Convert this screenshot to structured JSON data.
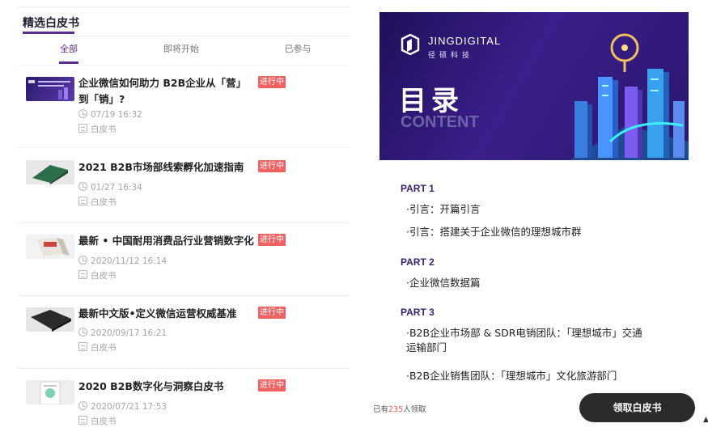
{
  "section_title": "精选白皮书",
  "tabs": [
    {
      "label": "全部",
      "active": true
    },
    {
      "label": "即将开始",
      "active": false
    },
    {
      "label": "已参与",
      "active": false
    }
  ],
  "items": [
    {
      "title": "企业微信如何助力 B2B企业从「营」到「销」?",
      "badge": "进行中",
      "time": "07/19 16:32",
      "type": "白皮书"
    },
    {
      "title": "2021 B2B市场部线索孵化加速指南",
      "badge": "进行中",
      "time": "01/27 16:34",
      "type": "白皮书"
    },
    {
      "title": "最新 • 中国耐用消费品行业营销数字化",
      "badge": "进行中",
      "time": "2020/11/12 16:14",
      "type": "白皮书"
    },
    {
      "title": "最新中文版•定义微信运营权威基准",
      "badge": "进行中",
      "time": "2020/09/17 16:21",
      "type": "白皮书"
    },
    {
      "title": "2020 B2B数字化与洞察白皮书",
      "badge": "进行中",
      "time": "2020/07/21 17:53",
      "type": "白皮书"
    }
  ],
  "banner": {
    "brand": "JINGDIGITAL",
    "brand_sub": "径硕科技",
    "title": "目录",
    "subtitle": "CONTENT"
  },
  "toc": [
    {
      "part": "PART 1",
      "lines": [
        "·引言：开篇引言",
        "·引言：搭建关于企业微信的理想城市群"
      ]
    },
    {
      "part": "PART 2",
      "lines": [
        "·企业微信数据篇"
      ]
    },
    {
      "part": "PART 3",
      "lines": [
        "·B2B企业市场部 & SDR电销团队：「理想城市」交通运输部门",
        "·B2B企业销售团队：「理想城市」文化旅游部门"
      ]
    }
  ],
  "footer": {
    "claimed_prefix": "已有",
    "claimed_count": "235",
    "claimed_suffix": "人领取",
    "button_label": "领取白皮书"
  },
  "colors": {
    "accent": "#5b2d8e",
    "badge": "#f06262",
    "button": "#2b2b2b"
  }
}
